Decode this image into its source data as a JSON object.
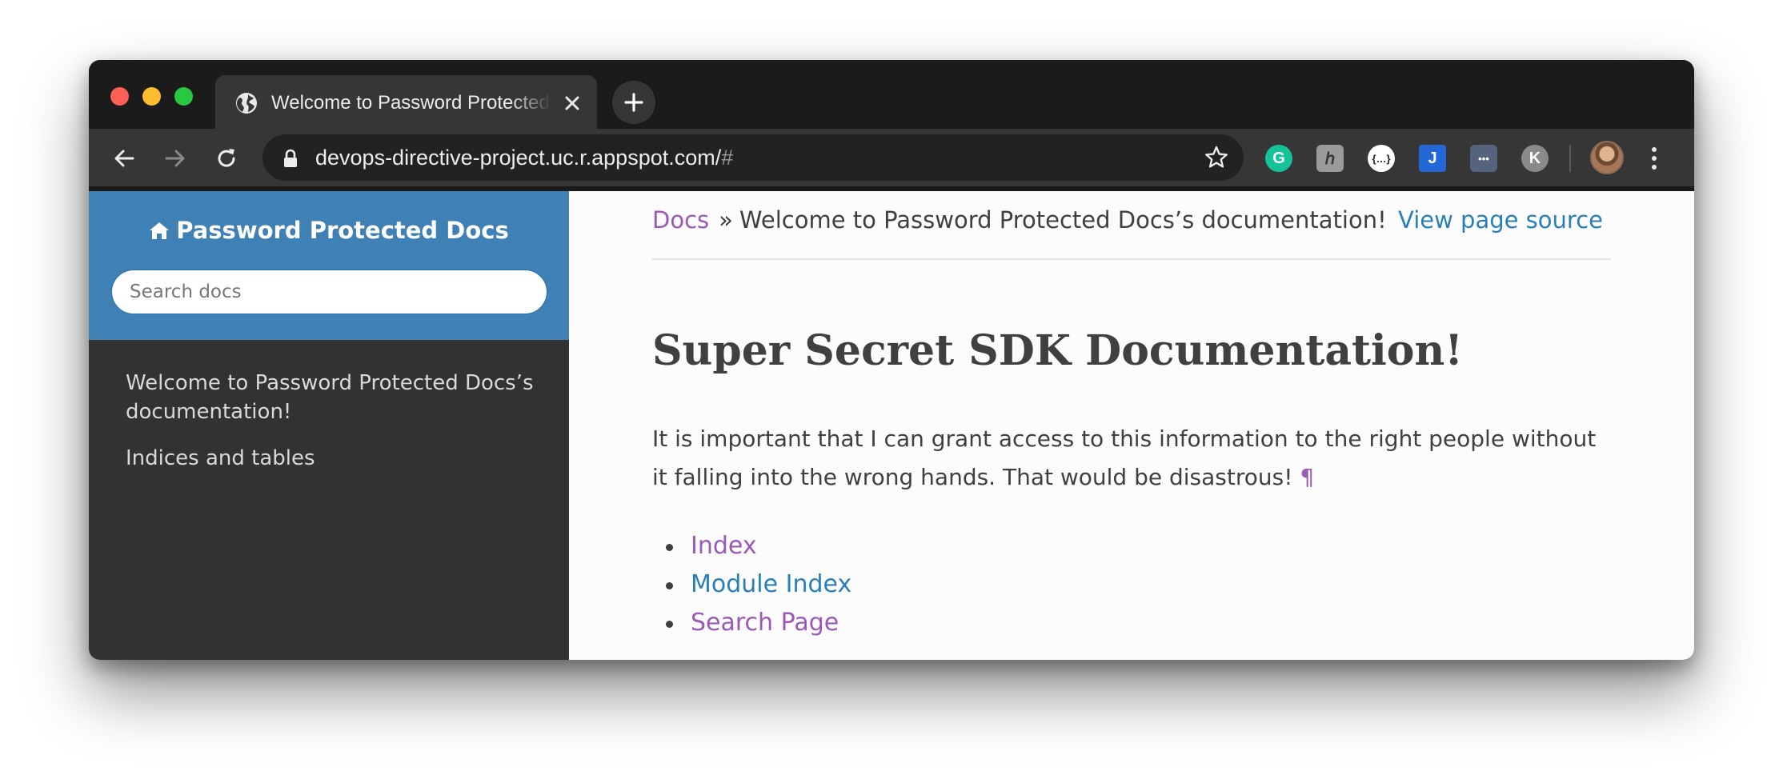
{
  "browser": {
    "tab_title": "Welcome to Password Protected Docs’s documentation!",
    "new_tab_label": "+",
    "url": "devops-directive-project.uc.r.appspot.com/",
    "url_hash": "#",
    "extensions": [
      {
        "name": "grammarly",
        "glyph": "G",
        "color": "#15c39a"
      },
      {
        "name": "ext-h",
        "glyph": "h",
        "color": "#9a9a9a"
      },
      {
        "name": "json-viewer",
        "glyph": "{…}",
        "color": "#ffffff"
      },
      {
        "name": "jira",
        "glyph": "J",
        "color": "#2684ff"
      },
      {
        "name": "more-dots",
        "glyph": "•••",
        "color": "#5a6a85"
      },
      {
        "name": "k-ext",
        "glyph": "K",
        "color": "#8a8a8a"
      }
    ]
  },
  "sidebar": {
    "brand": "Password Protected Docs",
    "search_placeholder": "Search docs",
    "nav": [
      "Welcome to Password Protected Docs’s documentation!",
      "Indices and tables"
    ]
  },
  "main": {
    "breadcrumb_home": "Docs",
    "breadcrumb_sep": "»",
    "breadcrumb_current": "Welcome to Password Protected Docs’s documentation!",
    "view_source": "View page source",
    "title": "Super Secret SDK Documentation!",
    "paragraph": "It is important that I can grant access to this information to the right people without it falling into the wrong hands. That would be disastrous!",
    "pilcrow": "¶",
    "links": [
      "Index",
      "Module Index",
      "Search Page"
    ]
  },
  "colors": {
    "sidebar_header": "#3f80b5",
    "sidebar_bg": "#343131",
    "link_visited": "#9b59b6",
    "link": "#2980b9"
  }
}
